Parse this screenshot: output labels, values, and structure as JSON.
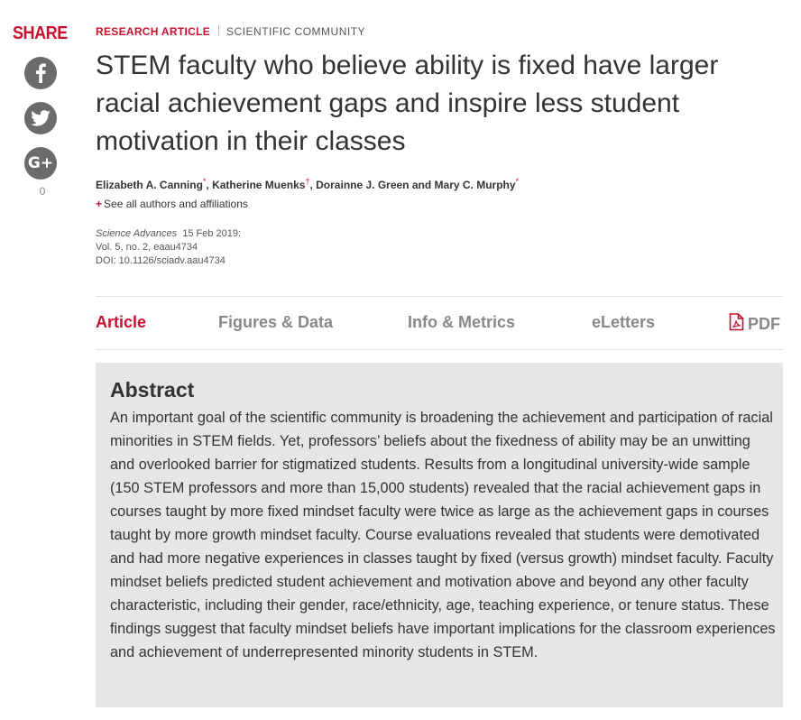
{
  "share": {
    "label": "SHARE",
    "count": "0",
    "buttons": [
      {
        "network": "facebook",
        "icon": "facebook-icon"
      },
      {
        "network": "twitter",
        "icon": "twitter-icon"
      },
      {
        "network": "google-plus",
        "icon": "google-plus-icon"
      }
    ]
  },
  "article": {
    "type": "RESEARCH ARTICLE",
    "section": "SCIENTIFIC COMMUNITY",
    "title": "STEM faculty who believe ability is fixed have larger racial achievement gaps and inspire less student motivation in their classes",
    "authors": [
      {
        "name": "Elizabeth A. Canning",
        "mark": "*",
        "sep": ", "
      },
      {
        "name": "Katherine Muenks",
        "mark": "†",
        "sep": ", "
      },
      {
        "name": "Dorainne J. Green",
        "mark": "",
        "sep": " and "
      },
      {
        "name": "Mary C. Murphy",
        "mark": "*",
        "sep": ""
      }
    ],
    "see_all": "See all authors and affiliations",
    "see_all_icon": "plus-icon",
    "journal": "Science Advances",
    "date": "15 Feb 2019:",
    "volume": "Vol. 5, no. 2, eaau4734",
    "doi": "DOI: 10.1126/sciadv.aau4734"
  },
  "tabs": [
    {
      "label": "Article",
      "active": true
    },
    {
      "label": "Figures & Data",
      "active": false
    },
    {
      "label": "Info & Metrics",
      "active": false
    },
    {
      "label": "eLetters",
      "active": false
    },
    {
      "label": "PDF",
      "active": false,
      "icon": "pdf-icon"
    }
  ],
  "abstract": {
    "heading": "Abstract",
    "text": "An important goal of the scientific community is broadening the achievement and participation of racial minorities in STEM fields. Yet, professors’ beliefs about the fixedness of ability may be an unwitting and overlooked barrier for stigmatized students. Results from a longitudinal university-wide sample (150 STEM professors and more than 15,000 students) revealed that the racial achievement gaps in courses taught by more fixed mindset faculty were twice as large as the achievement gaps in courses taught by more growth mindset faculty. Course evaluations revealed that students were demotivated and had more negative experiences in classes taught by fixed (versus growth) mindset faculty. Faculty mindset beliefs predicted student achievement and motivation above and beyond any other faculty characteristic, including their gender, race/ethnicity, age, teaching experience, or tenure status. These findings suggest that faculty mindset beliefs have important implications for the classroom experiences and achievement of underrepresented minority students in STEM."
  },
  "colors": {
    "accent": "#c8102e",
    "icon_bg": "#6b6b6b",
    "abstract_bg": "#e6e6e6"
  }
}
